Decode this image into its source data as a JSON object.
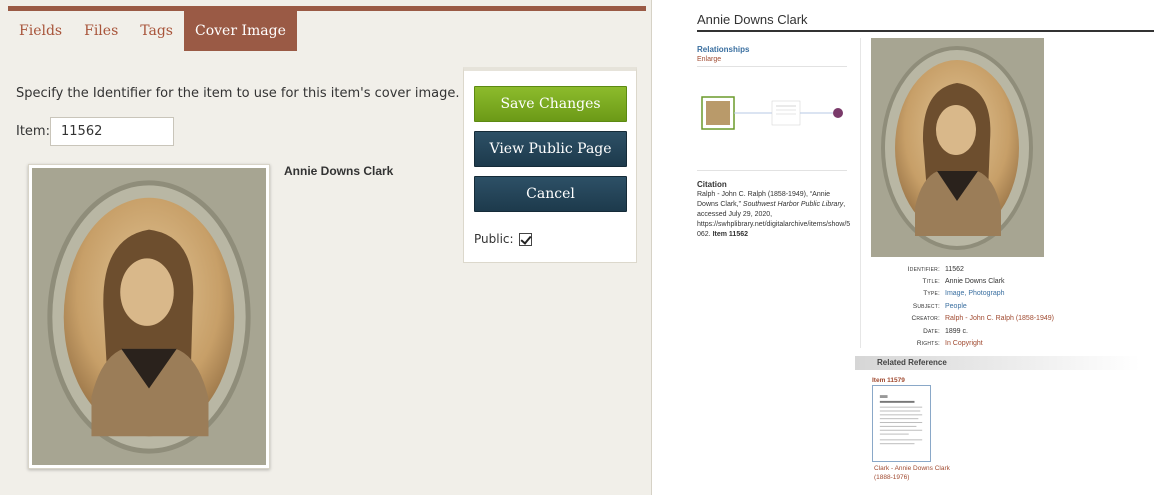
{
  "admin": {
    "tabs": [
      {
        "label": "Fields"
      },
      {
        "label": "Files"
      },
      {
        "label": "Tags"
      },
      {
        "label": "Cover Image"
      }
    ],
    "instruction": "Specify the Identifier for the item to use for this item's cover image.",
    "item_label": "Item:",
    "item_value": "11562",
    "cover_title": "Annie Downs Clark",
    "buttons": {
      "save": "Save Changes",
      "view_public": "View Public Page",
      "cancel": "Cancel"
    },
    "public_label": "Public:",
    "public_checked": true
  },
  "public_page": {
    "title": "Annie Downs Clark",
    "relationships": {
      "heading": "Relationships",
      "enlarge": "Enlarge"
    },
    "citation": {
      "heading": "Citation",
      "part1": "Ralph - John C. Ralph (1858-1949), “Annie Downs Clark,”",
      "source": "Southwest Harbor Public Library",
      "part2": ", accessed July 29, 2020, https://swhplibrary.net/digitalarchive/items/show/5",
      "part3": "062.",
      "item_ref": "Item 11562"
    },
    "metadata": [
      {
        "key": "Identifier:",
        "value": "11562",
        "style": ""
      },
      {
        "key": "Title:",
        "value": "Annie Downs Clark",
        "style": ""
      },
      {
        "key": "Type:",
        "value": "Image, Photograph",
        "style": "link"
      },
      {
        "key": "Subject:",
        "value": "People",
        "style": "link"
      },
      {
        "key": "Creator:",
        "value": "Ralph - John C. Ralph (1858-1949)",
        "style": "brown"
      },
      {
        "key": "Date:",
        "value": "1899 c.",
        "style": ""
      },
      {
        "key": "Rights:",
        "value": "In Copyright",
        "style": "brown"
      }
    ],
    "related": {
      "heading": "Related Reference",
      "item_id": "Item 11579",
      "caption_line1": "Clark - Annie Downs Clark",
      "caption_line2": "(1888-1976)"
    }
  },
  "colors": {
    "tab_active": "#9a5a45",
    "tab_text": "#a8543a",
    "save_green": "#7aa81f",
    "dark_blue": "#234458",
    "link_blue": "#3a6fa0",
    "link_brown": "#a04a30"
  }
}
